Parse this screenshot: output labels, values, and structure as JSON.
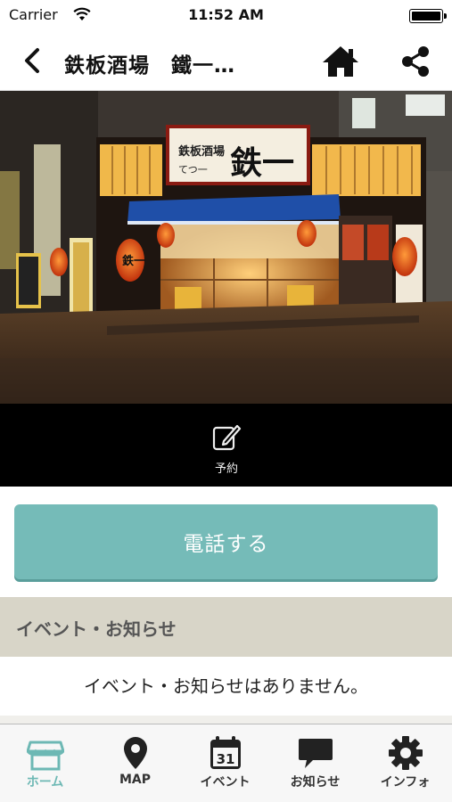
{
  "status_bar": {
    "carrier": "Carrier",
    "time": "11:52 AM"
  },
  "nav": {
    "title": "鉄板酒場　鐵一…"
  },
  "hero": {
    "sign_main": "鉄板酒場",
    "sign_sub": "てつ一",
    "sign_kanji": "鉄一",
    "lantern": "鉄一"
  },
  "reserve": {
    "label": "予約"
  },
  "call": {
    "label": "電話する"
  },
  "events": {
    "header": "イベント・お知らせ",
    "empty_message": "イベント・お知らせはありません。"
  },
  "tabs": [
    {
      "label": "ホーム",
      "icon": "shop-icon",
      "active": true
    },
    {
      "label": "MAP",
      "icon": "map-pin-icon",
      "active": false
    },
    {
      "label": "イベント",
      "icon": "calendar-icon",
      "active": false,
      "calendar_day": "31"
    },
    {
      "label": "お知らせ",
      "icon": "speech-bubble-icon",
      "active": false
    },
    {
      "label": "インフォ",
      "icon": "gear-icon",
      "active": false
    }
  ],
  "colors": {
    "accent": "#75bbb8",
    "section_bg": "#d8d5c8",
    "active_tab": "#6db8b4"
  }
}
